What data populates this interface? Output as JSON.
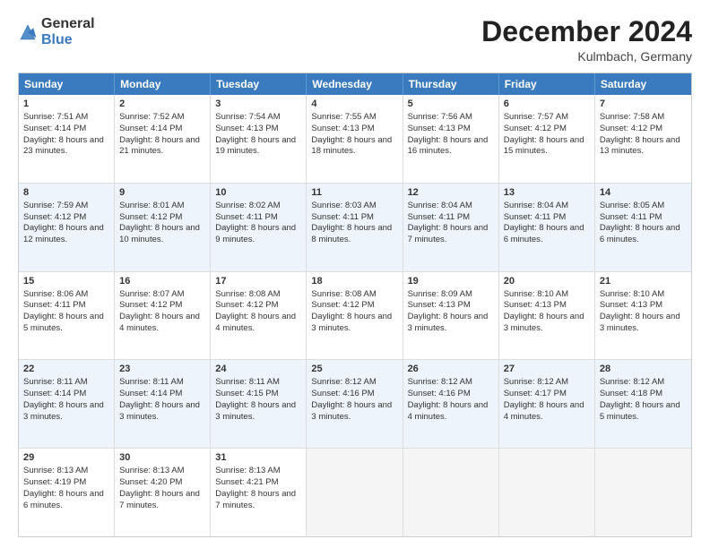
{
  "header": {
    "logo_general": "General",
    "logo_blue": "Blue",
    "month_title": "December 2024",
    "location": "Kulmbach, Germany"
  },
  "days_of_week": [
    "Sunday",
    "Monday",
    "Tuesday",
    "Wednesday",
    "Thursday",
    "Friday",
    "Saturday"
  ],
  "weeks": [
    {
      "alt": false,
      "cells": [
        {
          "day": "1",
          "sunrise": "7:51 AM",
          "sunset": "4:14 PM",
          "daylight": "8 hours and 23 minutes."
        },
        {
          "day": "2",
          "sunrise": "7:52 AM",
          "sunset": "4:14 PM",
          "daylight": "8 hours and 21 minutes."
        },
        {
          "day": "3",
          "sunrise": "7:54 AM",
          "sunset": "4:13 PM",
          "daylight": "8 hours and 19 minutes."
        },
        {
          "day": "4",
          "sunrise": "7:55 AM",
          "sunset": "4:13 PM",
          "daylight": "8 hours and 18 minutes."
        },
        {
          "day": "5",
          "sunrise": "7:56 AM",
          "sunset": "4:13 PM",
          "daylight": "8 hours and 16 minutes."
        },
        {
          "day": "6",
          "sunrise": "7:57 AM",
          "sunset": "4:12 PM",
          "daylight": "8 hours and 15 minutes."
        },
        {
          "day": "7",
          "sunrise": "7:58 AM",
          "sunset": "4:12 PM",
          "daylight": "8 hours and 13 minutes."
        }
      ]
    },
    {
      "alt": true,
      "cells": [
        {
          "day": "8",
          "sunrise": "7:59 AM",
          "sunset": "4:12 PM",
          "daylight": "8 hours and 12 minutes."
        },
        {
          "day": "9",
          "sunrise": "8:01 AM",
          "sunset": "4:12 PM",
          "daylight": "8 hours and 10 minutes."
        },
        {
          "day": "10",
          "sunrise": "8:02 AM",
          "sunset": "4:11 PM",
          "daylight": "8 hours and 9 minutes."
        },
        {
          "day": "11",
          "sunrise": "8:03 AM",
          "sunset": "4:11 PM",
          "daylight": "8 hours and 8 minutes."
        },
        {
          "day": "12",
          "sunrise": "8:04 AM",
          "sunset": "4:11 PM",
          "daylight": "8 hours and 7 minutes."
        },
        {
          "day": "13",
          "sunrise": "8:04 AM",
          "sunset": "4:11 PM",
          "daylight": "8 hours and 6 minutes."
        },
        {
          "day": "14",
          "sunrise": "8:05 AM",
          "sunset": "4:11 PM",
          "daylight": "8 hours and 6 minutes."
        }
      ]
    },
    {
      "alt": false,
      "cells": [
        {
          "day": "15",
          "sunrise": "8:06 AM",
          "sunset": "4:11 PM",
          "daylight": "8 hours and 5 minutes."
        },
        {
          "day": "16",
          "sunrise": "8:07 AM",
          "sunset": "4:12 PM",
          "daylight": "8 hours and 4 minutes."
        },
        {
          "day": "17",
          "sunrise": "8:08 AM",
          "sunset": "4:12 PM",
          "daylight": "8 hours and 4 minutes."
        },
        {
          "day": "18",
          "sunrise": "8:08 AM",
          "sunset": "4:12 PM",
          "daylight": "8 hours and 3 minutes."
        },
        {
          "day": "19",
          "sunrise": "8:09 AM",
          "sunset": "4:13 PM",
          "daylight": "8 hours and 3 minutes."
        },
        {
          "day": "20",
          "sunrise": "8:10 AM",
          "sunset": "4:13 PM",
          "daylight": "8 hours and 3 minutes."
        },
        {
          "day": "21",
          "sunrise": "8:10 AM",
          "sunset": "4:13 PM",
          "daylight": "8 hours and 3 minutes."
        }
      ]
    },
    {
      "alt": true,
      "cells": [
        {
          "day": "22",
          "sunrise": "8:11 AM",
          "sunset": "4:14 PM",
          "daylight": "8 hours and 3 minutes."
        },
        {
          "day": "23",
          "sunrise": "8:11 AM",
          "sunset": "4:14 PM",
          "daylight": "8 hours and 3 minutes."
        },
        {
          "day": "24",
          "sunrise": "8:11 AM",
          "sunset": "4:15 PM",
          "daylight": "8 hours and 3 minutes."
        },
        {
          "day": "25",
          "sunrise": "8:12 AM",
          "sunset": "4:16 PM",
          "daylight": "8 hours and 3 minutes."
        },
        {
          "day": "26",
          "sunrise": "8:12 AM",
          "sunset": "4:16 PM",
          "daylight": "8 hours and 4 minutes."
        },
        {
          "day": "27",
          "sunrise": "8:12 AM",
          "sunset": "4:17 PM",
          "daylight": "8 hours and 4 minutes."
        },
        {
          "day": "28",
          "sunrise": "8:12 AM",
          "sunset": "4:18 PM",
          "daylight": "8 hours and 5 minutes."
        }
      ]
    },
    {
      "alt": false,
      "cells": [
        {
          "day": "29",
          "sunrise": "8:13 AM",
          "sunset": "4:19 PM",
          "daylight": "8 hours and 6 minutes."
        },
        {
          "day": "30",
          "sunrise": "8:13 AM",
          "sunset": "4:20 PM",
          "daylight": "8 hours and 7 minutes."
        },
        {
          "day": "31",
          "sunrise": "8:13 AM",
          "sunset": "4:21 PM",
          "daylight": "8 hours and 7 minutes."
        },
        {
          "day": "",
          "sunrise": "",
          "sunset": "",
          "daylight": ""
        },
        {
          "day": "",
          "sunrise": "",
          "sunset": "",
          "daylight": ""
        },
        {
          "day": "",
          "sunrise": "",
          "sunset": "",
          "daylight": ""
        },
        {
          "day": "",
          "sunrise": "",
          "sunset": "",
          "daylight": ""
        }
      ]
    }
  ],
  "labels": {
    "sunrise": "Sunrise:",
    "sunset": "Sunset:",
    "daylight": "Daylight:"
  }
}
